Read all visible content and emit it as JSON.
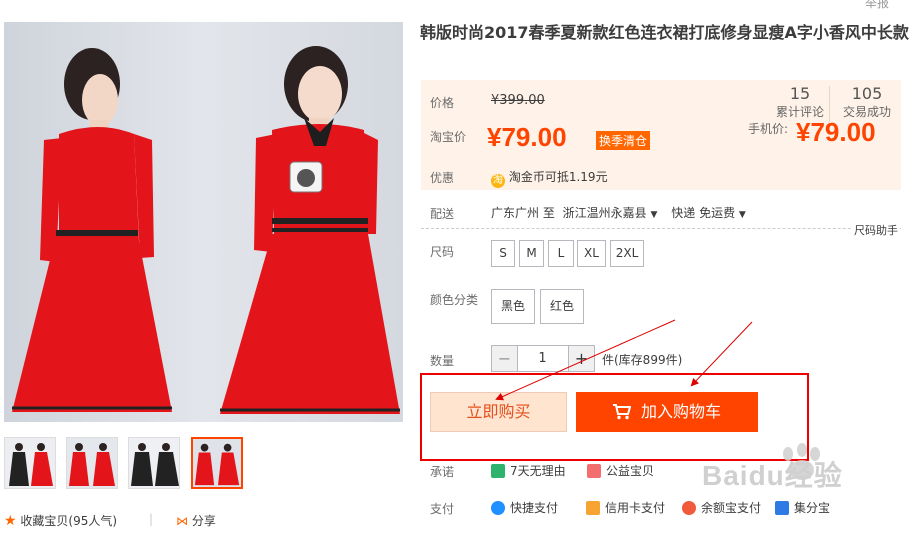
{
  "header": {
    "report_label": "举报"
  },
  "gallery": {
    "thumbnails": [
      "thumb-1",
      "thumb-2",
      "thumb-3",
      "thumb-4"
    ],
    "active_index": 3
  },
  "share_row": {
    "favorite_label": "收藏宝贝",
    "favorite_count": "(95人气)",
    "share_label": "分享"
  },
  "product": {
    "title": "韩版时尚2017春季夏新款红色连衣裙打底修身显瘦A字小香风中长款"
  },
  "price": {
    "label": "价格",
    "original": "¥399.00",
    "taobao_label": "淘宝价",
    "current": "¥79.00",
    "badge": "换季清仓",
    "reviews_count": "15",
    "reviews_label": "累计评论",
    "deals_count": "105",
    "deals_label": "交易成功",
    "phone_label": "手机价:",
    "phone_price": "¥79.00"
  },
  "promo": {
    "label": "优惠",
    "coin_glyph": "淘",
    "text": "淘金币可抵",
    "amount": "1.19元"
  },
  "delivery": {
    "label": "配送",
    "from": "广东广州 至",
    "to": "浙江温州永嘉县",
    "method": "快递 免运费"
  },
  "size": {
    "label": "尺码",
    "guide": "尺码助手",
    "options": [
      "S",
      "M",
      "L",
      "XL",
      "2XL"
    ]
  },
  "color": {
    "label": "颜色分类",
    "options": [
      "黑色",
      "红色"
    ]
  },
  "quantity": {
    "label": "数量",
    "minus": "−",
    "value": "1",
    "plus": "+",
    "stock": "件(库存899件)"
  },
  "actions": {
    "buy_now": "立即购买",
    "add_to_cart": "加入购物车"
  },
  "promise": {
    "label": "承诺",
    "items": [
      "7天无理由",
      "公益宝贝"
    ]
  },
  "payment": {
    "label": "支付",
    "items": [
      "快捷支付",
      "信用卡支付",
      "余额宝支付",
      "集分宝"
    ]
  },
  "watermark": {
    "text": "Baidu经验"
  },
  "colors": {
    "accent": "#ff4400",
    "price_bg": "#fff2e8",
    "buy_bg": "#ffe4d0",
    "highlight": "#ee0000"
  }
}
